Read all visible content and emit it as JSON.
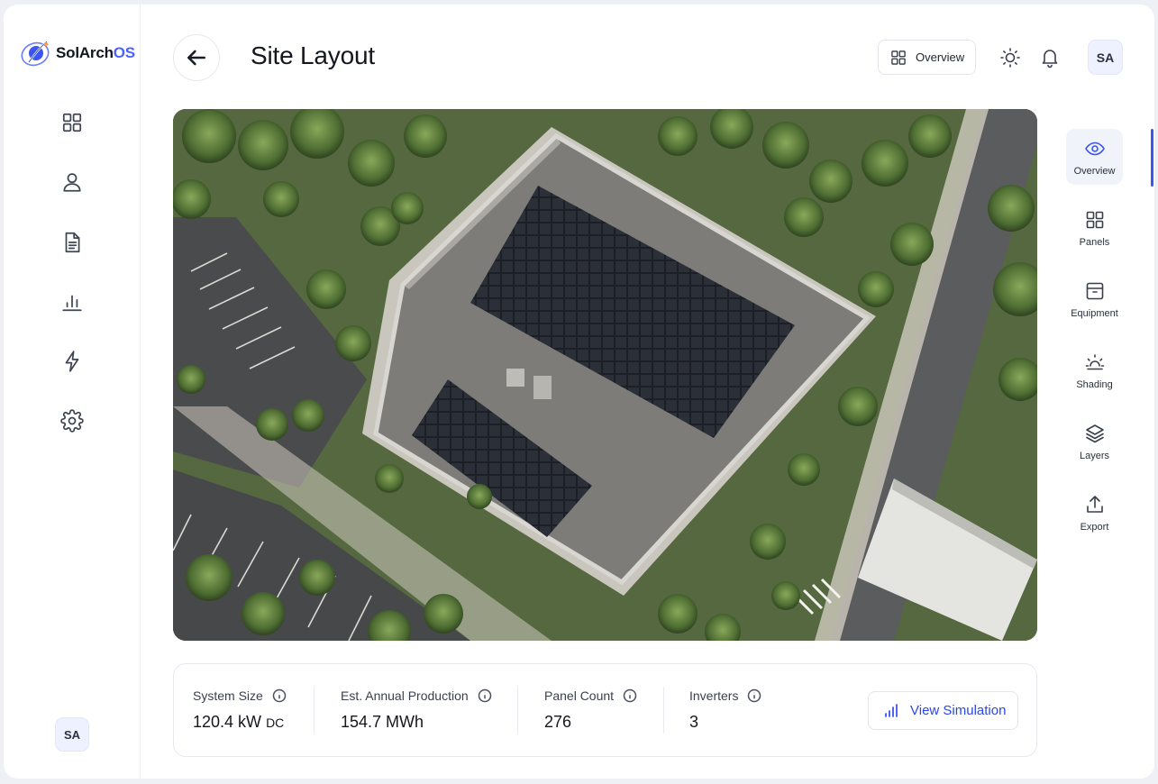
{
  "app": {
    "logo_main": "SolArch",
    "logo_accent": "OS",
    "brand_color": "#4a63ff"
  },
  "sidebar": {
    "items": [
      {
        "icon": "grid-icon",
        "label": "Dashboard"
      },
      {
        "icon": "user-icon",
        "label": "Users"
      },
      {
        "icon": "document-icon",
        "label": "Documents"
      },
      {
        "icon": "chart-icon",
        "label": "Analytics"
      },
      {
        "icon": "lightning-icon",
        "label": "Energy"
      },
      {
        "icon": "gear-icon",
        "label": "Settings"
      }
    ],
    "user_initials": "SA"
  },
  "header": {
    "title": "Site Layout",
    "overview_label": "Overview",
    "user_initials": "SA"
  },
  "tools": [
    {
      "label": "Overview",
      "icon": "eye-icon",
      "active": true
    },
    {
      "label": "Panels",
      "icon": "grid-icon",
      "active": false
    },
    {
      "label": "Equipment",
      "icon": "box-icon",
      "active": false
    },
    {
      "label": "Shading",
      "icon": "sun-icon",
      "active": false
    },
    {
      "label": "Layers",
      "icon": "layers-icon",
      "active": false
    },
    {
      "label": "Export",
      "icon": "upload-icon",
      "active": false
    }
  ],
  "stats": {
    "system_size": {
      "label": "System Size",
      "value": "120.4 kW",
      "unit": "DC"
    },
    "annual_production": {
      "label": "Est. Annual Production",
      "value": "154.7 MWh"
    },
    "panel_count": {
      "label": "Panel Count",
      "value": "276"
    },
    "inverters": {
      "label": "Inverters",
      "value": "3"
    },
    "simulation_label": "View Simulation"
  }
}
